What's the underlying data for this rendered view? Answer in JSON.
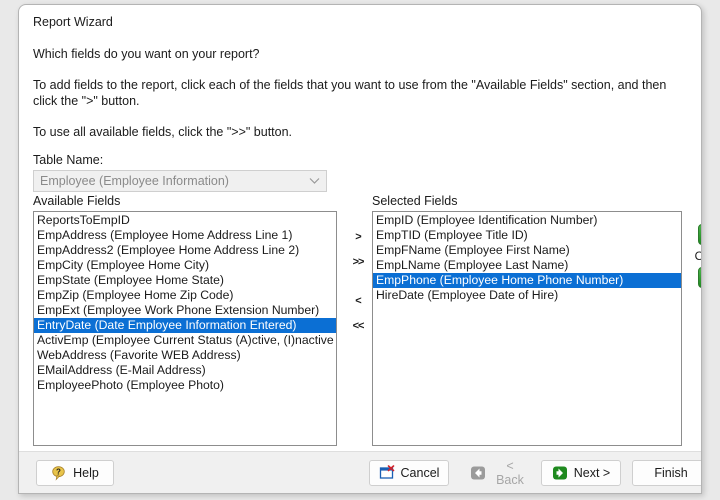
{
  "window": {
    "title": "Report Wizard"
  },
  "content": {
    "question": "Which fields do you want on your report?",
    "instruction_1": "To add fields to the report, click each of the fields that you want to use from the \"Available Fields\" section, and then click the \">\" button.",
    "instruction_2": "To use all available fields, click the \">>\" button.",
    "table_name_label": "Table Name:",
    "table_name_value": "Employee  (Employee Information)",
    "table_name_icon": "chevron-down-icon"
  },
  "available": {
    "label": "Available Fields",
    "items": [
      {
        "text": "ReportsToEmpID",
        "selected": false
      },
      {
        "text": "EmpAddress  (Employee Home Address Line 1)",
        "selected": false
      },
      {
        "text": "EmpAddress2  (Employee Home Address Line 2)",
        "selected": false
      },
      {
        "text": "EmpCity  (Employee Home City)",
        "selected": false
      },
      {
        "text": "EmpState  (Employee Home State)",
        "selected": false
      },
      {
        "text": "EmpZip  (Employee Home Zip Code)",
        "selected": false
      },
      {
        "text": "EmpExt  (Employee Work Phone Extension Number)",
        "selected": false
      },
      {
        "text": "EntryDate  (Date Employee Information Entered)",
        "selected": true
      },
      {
        "text": "ActivEmp  (Employee Current Status (A)ctive, (I)nactive",
        "selected": false
      },
      {
        "text": "WebAddress  (Favorite WEB Address)",
        "selected": false
      },
      {
        "text": "EMailAddress  (E-Mail Address)",
        "selected": false
      },
      {
        "text": "EmployeePhoto  (Employee Photo)",
        "selected": false
      }
    ]
  },
  "selected": {
    "label": "Selected Fields",
    "items": [
      {
        "text": "EmpID  (Employee Identification Number)",
        "selected": false
      },
      {
        "text": "EmpTID  (Employee Title ID)",
        "selected": false
      },
      {
        "text": "EmpFName  (Employee First Name)",
        "selected": false
      },
      {
        "text": "EmpLName  (Employee Last Name)",
        "selected": false
      },
      {
        "text": "EmpPhone  (Employee Home Phone Number)",
        "selected": true
      },
      {
        "text": "HireDate  (Employee Date of Hire)",
        "selected": false
      }
    ]
  },
  "transfer": {
    "add_one": ">",
    "add_all": ">>",
    "remove_one": "<",
    "remove_all": "<<"
  },
  "order": {
    "label": "Order",
    "up_icon": "arrow-up-icon",
    "down_icon": "arrow-down-icon"
  },
  "footer": {
    "help": "Help",
    "help_icon": "question-bubble-icon",
    "cancel": "Cancel",
    "cancel_icon": "window-close-icon",
    "back": "< Back",
    "back_icon": "arrow-left-icon",
    "next": "Next >",
    "next_icon": "arrow-right-icon",
    "finish": "Finish"
  },
  "colors": {
    "selection_blue": "#0b6fd4",
    "order_green": "#1f8a1f",
    "next_green": "#1f8a1f",
    "help_yellow": "#e8c44a",
    "cancel_red": "#d0232b",
    "window_blue": "#1a5fb4"
  }
}
